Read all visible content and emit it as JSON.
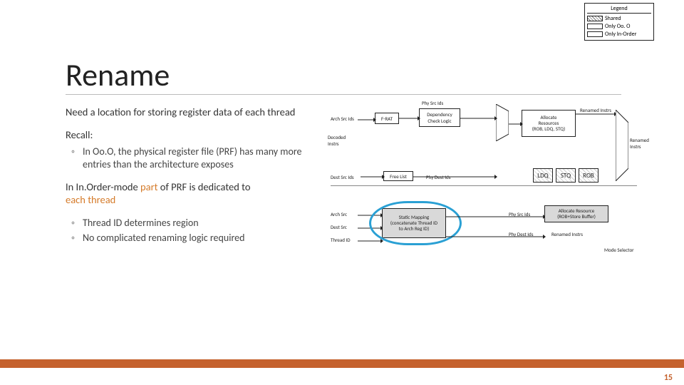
{
  "title": "Rename",
  "body": {
    "lead1": "Need a location for storing register data of each thread",
    "recall": "Recall:",
    "recall_bullet": "In Oo.O, the physical register file (PRF) has many more entries than the architecture exposes",
    "inorder_pre": "In In.Order-mode ",
    "inorder_part": "part",
    "inorder_post": " of PRF is dedicated to ",
    "inorder_dedicated": "each thread",
    "io_b1": "Thread ID determines region",
    "io_b2": "No complicated renaming logic required"
  },
  "legend": {
    "title": "Legend",
    "shared": "Shared",
    "onlyooo": "Only Oo. O",
    "onlyio": "Only In-Order"
  },
  "diagram": {
    "arch_src_ids": "Arch Src Ids",
    "decoded_instrs": "Decoded\nInstrs",
    "frat": "F-RAT",
    "dep": "Dependency\nCheck Logic",
    "phy_src_ids_top": "Phy Src Ids",
    "renamed_instrs_top": "Renamed Instrs",
    "dest_src_ids": "Dest Src Ids",
    "free_list": "Free List",
    "phy_dest_ids": "Phy Dest Ids",
    "ldq": "LDQ",
    "stq": "STQ",
    "rob": "ROB",
    "alloc_top": "Allocate\nResources\n(ROB, LDQ, STQ)",
    "renamed_instrs_right": "Renamed\nInstrs",
    "arch_src": "Arch Src",
    "dest_src": "Dest Src",
    "thread_id": "Thread ID",
    "static": "Static Mapping\n(concatenate Thread ID\nto Arch Reg ID)",
    "phy_src_ids2": "Phy Src Ids",
    "phy_dest_ids2": "Phy Dest Ids",
    "alloc_bot": "Allocate Resource\n(ROB+Store Buffer)",
    "renamed_instrs2": "Renamed Instrs",
    "mode_sel": "Mode Selector"
  },
  "pagenum": "15"
}
